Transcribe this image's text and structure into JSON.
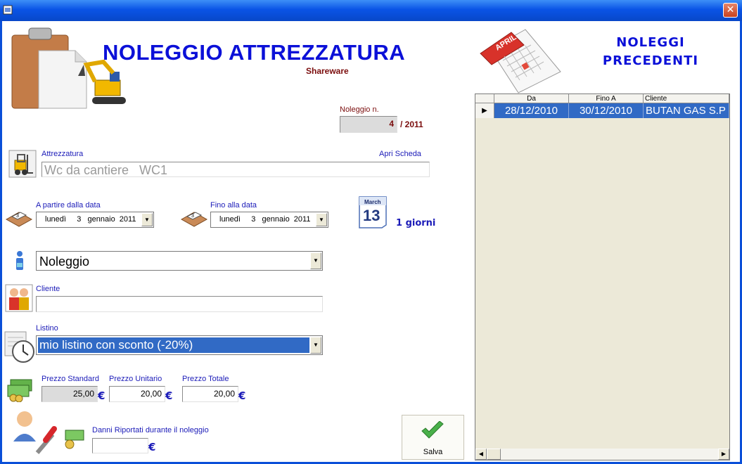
{
  "window": {
    "close_glyph": "✕"
  },
  "header": {
    "title": "NOLEGGIO ATTREZZATURA",
    "subtitle": "Shareware",
    "right_title_line1": "NOLEGGI",
    "right_title_line2": "PRECEDENTI",
    "calendar_icon_month": "APRIL"
  },
  "rental": {
    "number_label": "Noleggio n.",
    "number": "4",
    "year": "/ 2011"
  },
  "equipment": {
    "label": "Attrezzatura",
    "open_sheet_link": "Apri Scheda",
    "value": "Wc da cantiere   WC1"
  },
  "dates": {
    "from_label": "A partire dalla data",
    "from_value": "lunedì     3   gennaio  2011",
    "to_label": "Fino alla data",
    "to_value": "lunedì     3   gennaio  2011",
    "calendar_month": "March",
    "calendar_day": "13",
    "days_count": "1 giorni"
  },
  "type": {
    "value": "Noleggio"
  },
  "client": {
    "label": "Cliente",
    "value": ""
  },
  "price_list": {
    "label": "Listino",
    "value": "mio listino con sconto (-20%)"
  },
  "prices": {
    "standard_label": "Prezzo Standard",
    "standard_value": "25,00",
    "unit_label": "Prezzo Unitario",
    "unit_value": "20,00",
    "total_label": "Prezzo Totale",
    "total_value": "20,00",
    "currency": "€"
  },
  "damages": {
    "label": "Danni Riportati durante il noleggio",
    "value": "",
    "currency": "€"
  },
  "save_button": {
    "label": "Salva"
  },
  "previous_rentals": {
    "columns": [
      "Da",
      "Fino A",
      "Cliente"
    ],
    "rows": [
      {
        "from": "28/12/2010",
        "to": "30/12/2010",
        "client": "BUTAN GAS S.P"
      }
    ]
  },
  "colors": {
    "accent_blue": "#0b10d8",
    "label_blue": "#1b1bb8",
    "dark_red": "#7a0c0c",
    "selection": "#316ac5"
  }
}
